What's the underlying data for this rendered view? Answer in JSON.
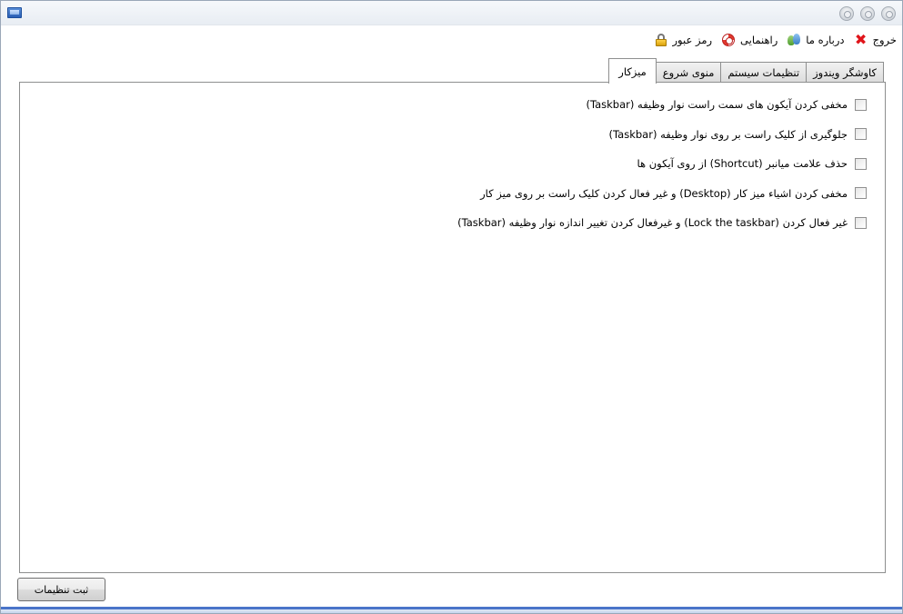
{
  "menu": {
    "password_label": "رمز عبور",
    "help_label": "راهنمایی",
    "about_label": "درباره ما",
    "exit_label": "خروج"
  },
  "tabs": [
    {
      "label": "میزکار"
    },
    {
      "label": "منوی شروع"
    },
    {
      "label": "تنظیمات سیستم"
    },
    {
      "label": "کاوشگر ویندوز"
    }
  ],
  "options": [
    {
      "label": "مخفی کردن آیکون های سمت راست نوار وظیفه (Taskbar)",
      "checked": false
    },
    {
      "label": "جلوگیری از کلیک راست بر روی نوار وظیفه (Taskbar)",
      "checked": false
    },
    {
      "label": "حذف علامت میانبر (Shortcut) از روی آیکون ها",
      "checked": false
    },
    {
      "label": "مخفی کردن اشیاء میز کار (Desktop) و غیر فعال کردن کلیک راست بر روی میز کار",
      "checked": false
    },
    {
      "label": "غیر فعال کردن (Lock the taskbar) و غیرفعال کردن تغییر اندازه نوار وظیفه (Taskbar)",
      "checked": false
    }
  ],
  "save_button_label": "ثبت تنظیمات"
}
